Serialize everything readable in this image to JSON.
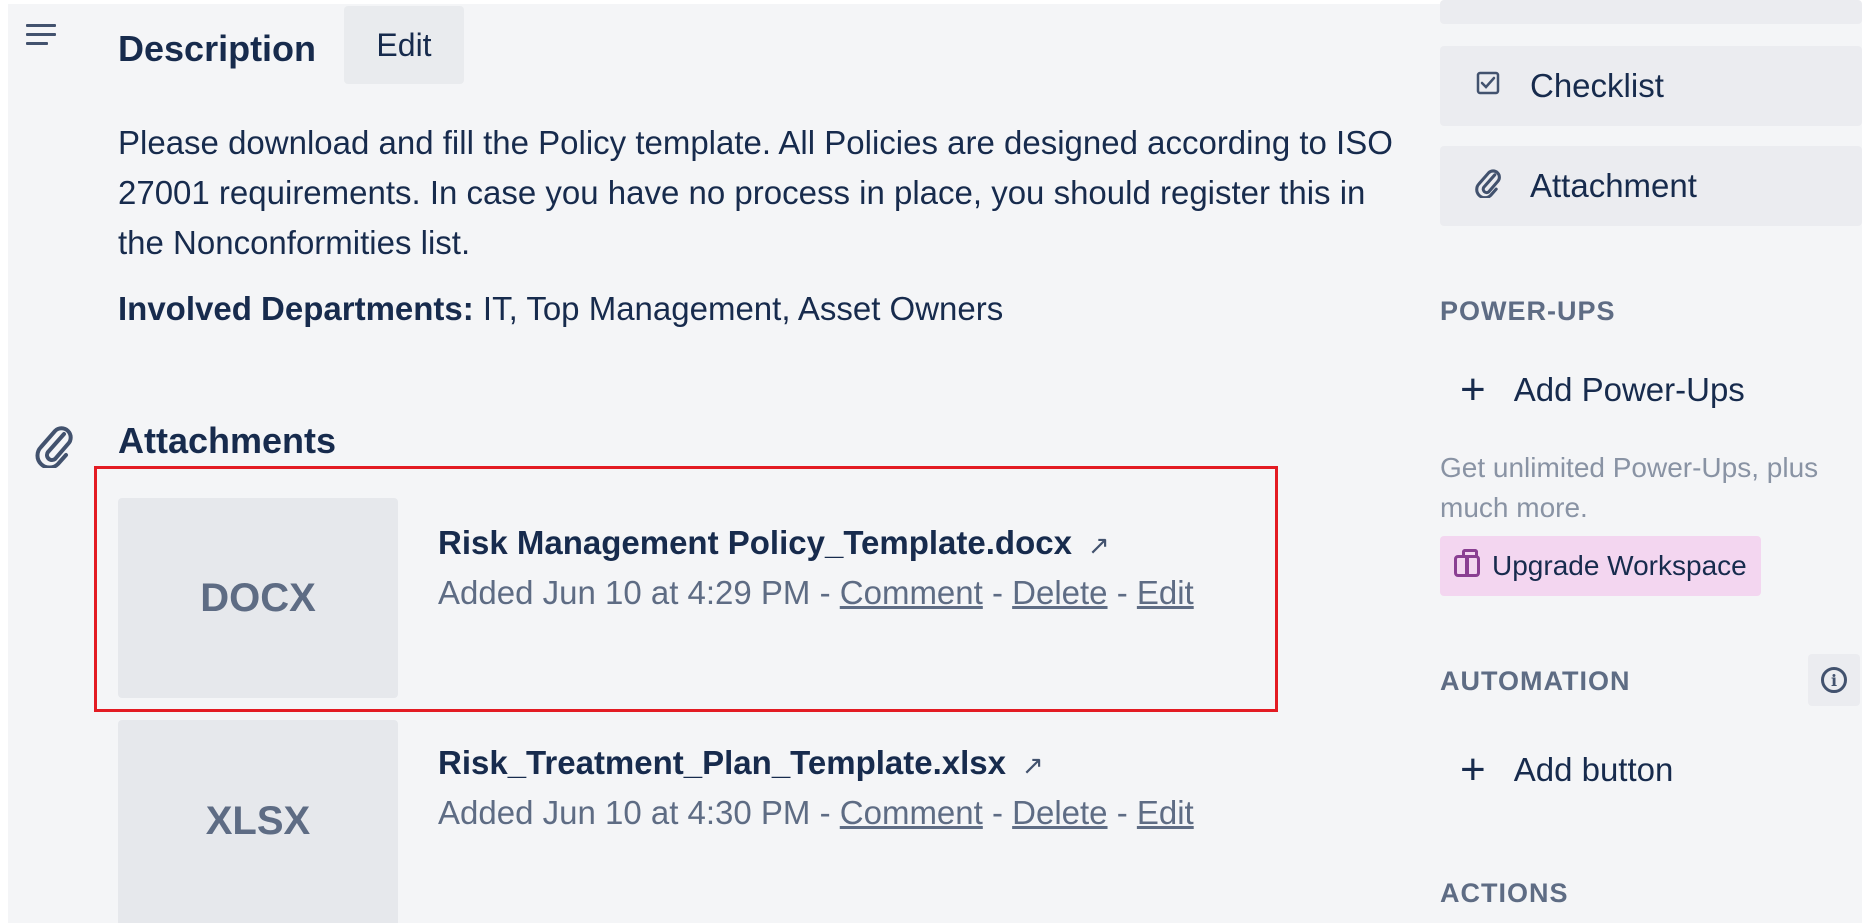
{
  "description": {
    "icon": "description-icon",
    "heading": "Description",
    "edit_label": "Edit",
    "text": "Please download and fill the Policy template. All Policies are designed according to ISO 27001 requirements. In case you have no process in place, you should register this in the Nonconformities list.",
    "involved_label": "Involved Departments:",
    "involved_value": " IT, Top Management, Asset Owners"
  },
  "attachments": {
    "icon": "paperclip-icon",
    "heading": "Attachments",
    "items": [
      {
        "thumb": "DOCX",
        "name": "Risk Management Policy_Template.docx",
        "open_icon": "↗",
        "added": "Added Jun 10 at 4:29 PM - ",
        "comment": "Comment",
        "delete": "Delete",
        "edit": "Edit",
        "separator": " - "
      },
      {
        "thumb": "XLSX",
        "name": "Risk_Treatment_Plan_Template.xlsx",
        "open_icon": "↗",
        "added": "Added Jun 10 at 4:30 PM - ",
        "comment": "Comment",
        "delete": "Delete",
        "edit": "Edit",
        "separator": " - "
      }
    ]
  },
  "sidebar": {
    "checklist": {
      "icon": "checklist-icon",
      "label": "Checklist"
    },
    "attachment": {
      "icon": "paperclip-icon",
      "label": "Attachment"
    },
    "power_ups": {
      "heading": "POWER-UPS",
      "add_label": "Add Power-Ups",
      "promo": "Get unlimited Power-Ups, plus much more.",
      "upgrade_label": "Upgrade Workspace"
    },
    "automation": {
      "heading": "AUTOMATION",
      "info_icon": "info-icon",
      "add_label": "Add button"
    },
    "actions": {
      "heading": "ACTIONS"
    }
  },
  "colors": {
    "highlight_border": "#e31b23",
    "upgrade_bg": "#f3d6f0",
    "upgrade_icon": "#8a3f92"
  }
}
